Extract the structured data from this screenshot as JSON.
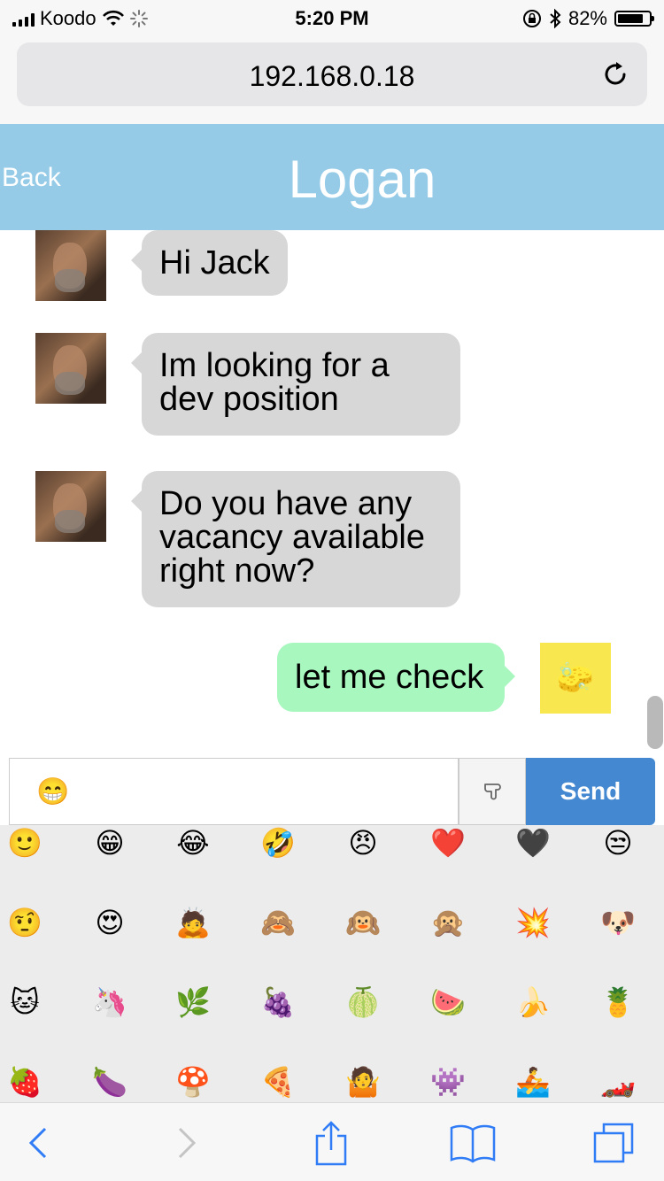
{
  "status_bar": {
    "carrier": "Koodo",
    "time": "5:20 PM",
    "battery": "82%",
    "battery_level": 0.82
  },
  "browser": {
    "url": "192.168.0.18"
  },
  "header": {
    "back_label": "Back",
    "title": "Logan"
  },
  "messages": [
    {
      "from": "Logan",
      "direction": "incoming",
      "text": "Hi Jack"
    },
    {
      "from": "Logan",
      "direction": "incoming",
      "text": "Im looking for a dev position"
    },
    {
      "from": "Logan",
      "direction": "incoming",
      "text": "Do you have any vacancy available right now?"
    },
    {
      "from": "me",
      "direction": "outgoing",
      "text": "let me check"
    }
  ],
  "input": {
    "value": "😁",
    "send_label": "Send"
  },
  "emoji_picker": [
    "🙂",
    "😁",
    "😂",
    "🤣",
    "😠",
    "❤️",
    "🖤",
    "😒",
    "🤨",
    "😍",
    "🙇",
    "🙈",
    "🙉",
    "🙊",
    "💥",
    "🐶",
    "🐱",
    "🦄",
    "🌿",
    "🍇",
    "🍈",
    "🍉",
    "🍌",
    "🍍",
    "🍓",
    "🍆",
    "🍄",
    "🍕",
    "🤷",
    "👾",
    "🚣",
    "🏎️"
  ],
  "colors": {
    "header": "#96cbe8",
    "incoming_bubble": "#d7d7d7",
    "outgoing_bubble": "#a7f7bf",
    "send_button": "#4388d0"
  }
}
